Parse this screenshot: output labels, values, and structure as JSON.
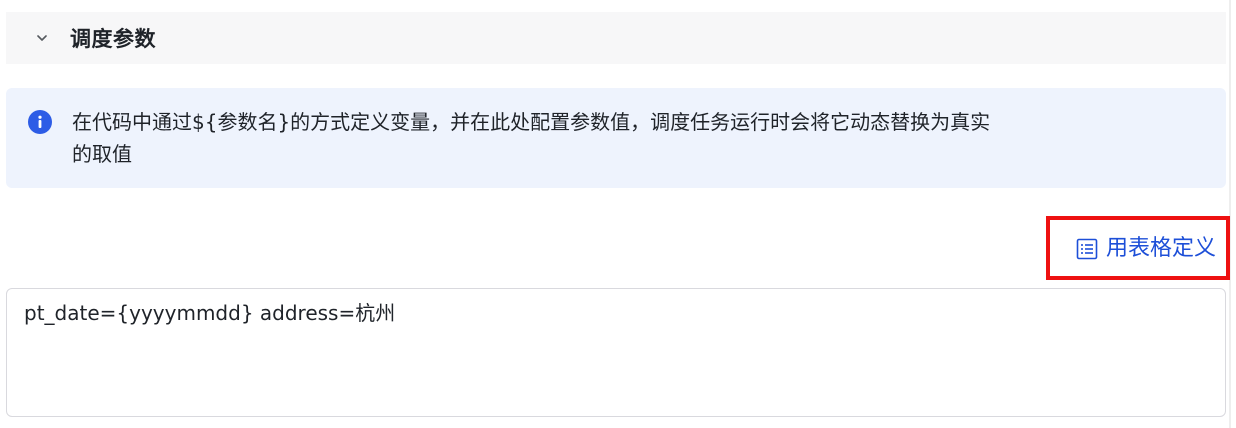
{
  "section": {
    "title": "调度参数",
    "toggle_icon": "chevron-down-icon"
  },
  "info": {
    "icon": "info-icon",
    "line1": "在代码中通过${参数名}的方式定义变量，并在此处配置参数值，调度任务运行时会将它动态替换为真实",
    "line2": "的取值"
  },
  "table_define": {
    "icon": "list-icon",
    "label": "用表格定义"
  },
  "params": {
    "value": "pt_date={yyyymmdd} address=杭州"
  },
  "colors": {
    "accent": "#1d4fd8",
    "info_bg": "#eef3fd",
    "highlight": "#ee1111"
  }
}
